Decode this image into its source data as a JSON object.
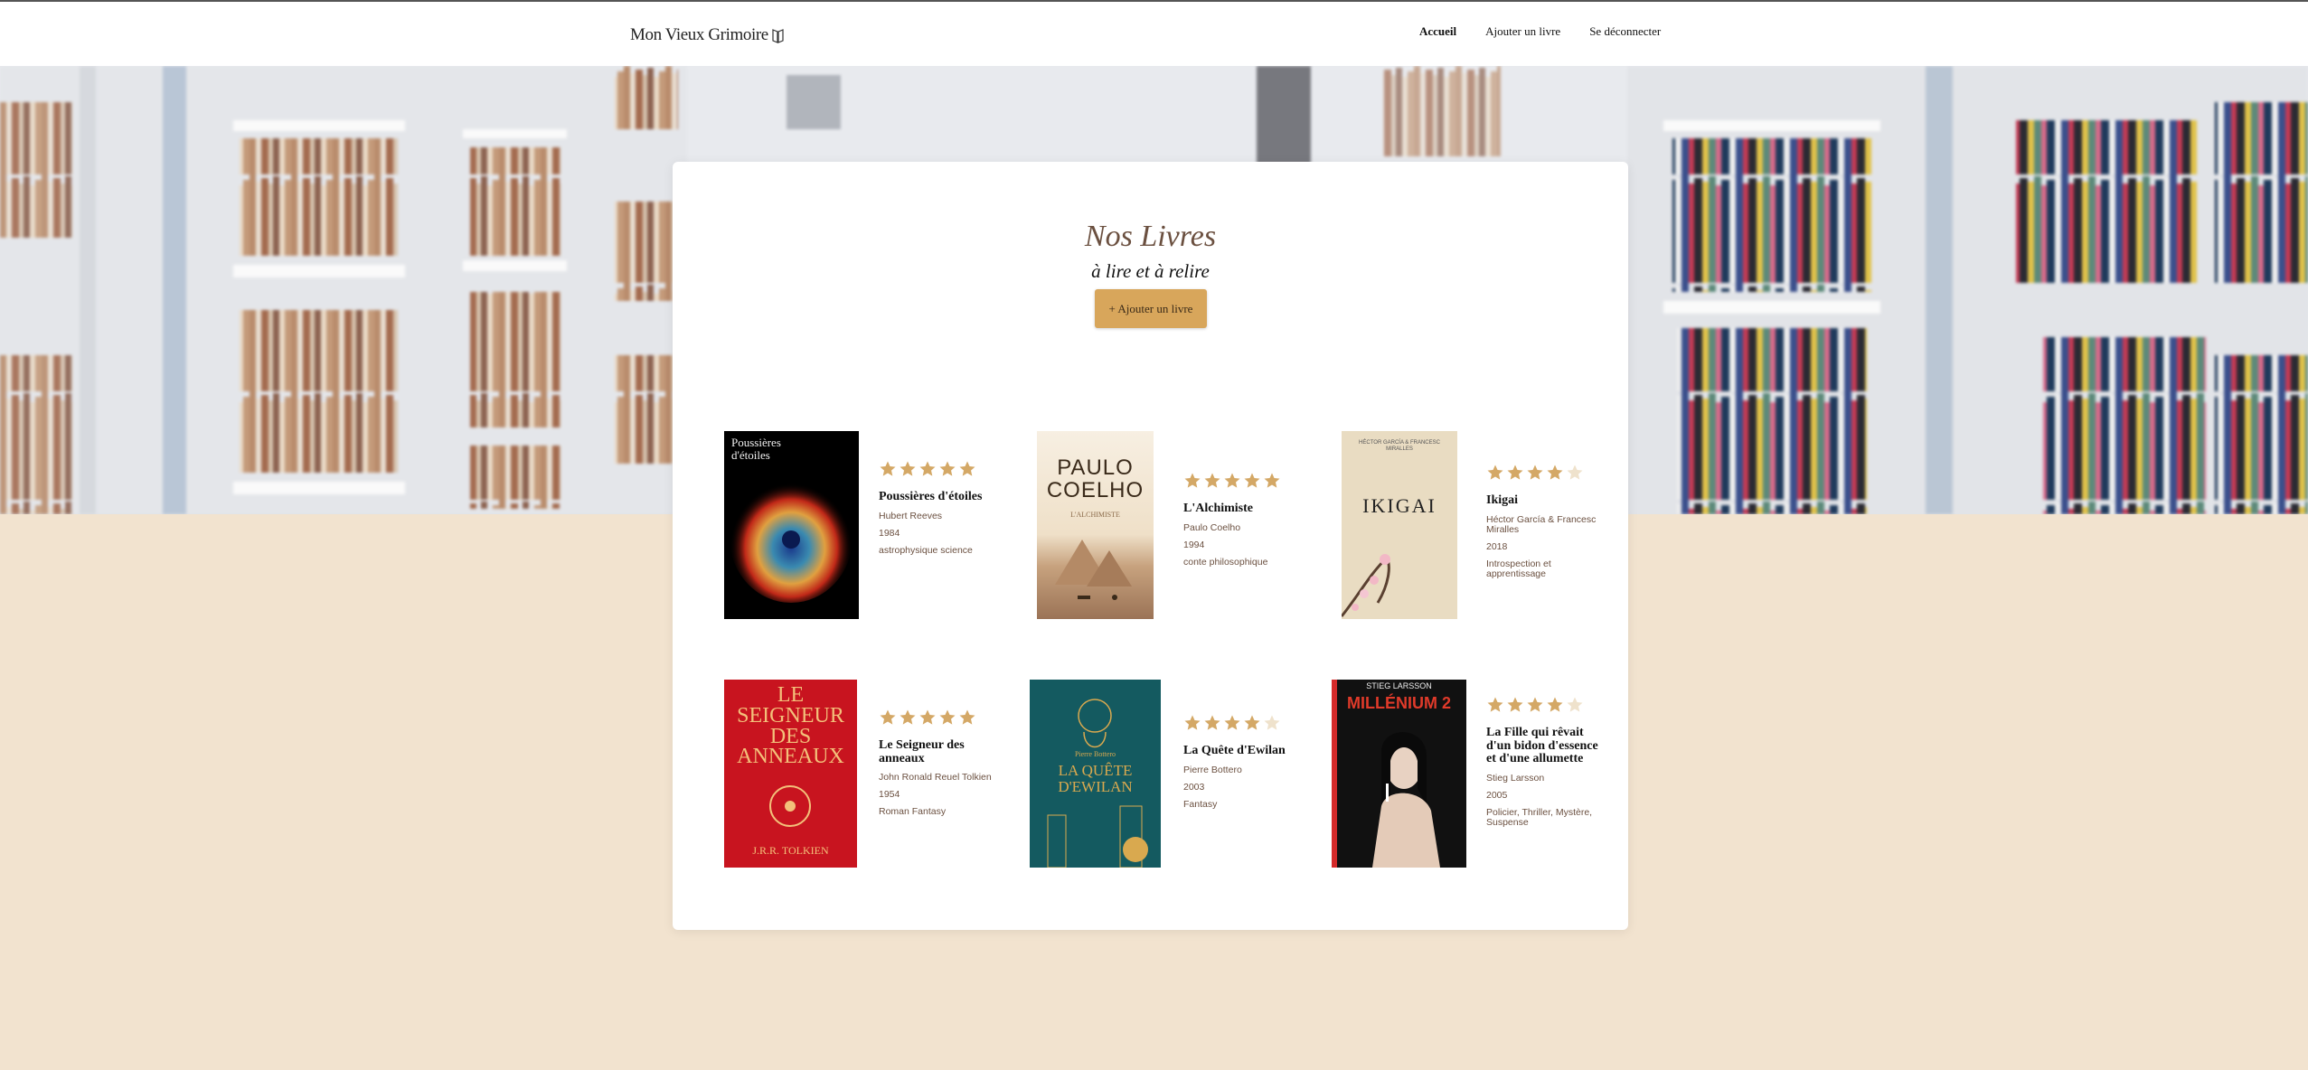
{
  "header": {
    "logo": "Mon Vieux Grimoire",
    "nav": [
      {
        "label": "Accueil",
        "active": true
      },
      {
        "label": "Ajouter un livre",
        "active": false
      },
      {
        "label": "Se déconnecter",
        "active": false
      }
    ]
  },
  "main": {
    "title": "Nos Livres",
    "subtitle": "à lire et à relire",
    "add_button": "+ Ajouter un livre"
  },
  "books": [
    {
      "title": "Poussières d'étoiles",
      "author": "Hubert Reeves",
      "year": "1984",
      "genre": "astrophysique science",
      "rating": 5,
      "cover_title": "Poussières d'étoiles"
    },
    {
      "title": "L'Alchimiste",
      "author": "Paulo Coelho",
      "year": "1994",
      "genre": "conte philosophique",
      "rating": 5,
      "cover_title": "PAULO COELHO",
      "cover_sub": "L'ALCHIMISTE"
    },
    {
      "title": "Ikigai",
      "author": "Héctor García & Francesc Miralles",
      "year": "2018",
      "genre": "Introspection et apprentissage",
      "rating": 4,
      "cover_title": "IKIGAI",
      "cover_sub": "HÉCTOR GARCÍA & FRANCESC MIRALLES"
    },
    {
      "title": "Le Seigneur des anneaux",
      "author": "John Ronald Reuel Tolkien",
      "year": "1954",
      "genre": "Roman Fantasy",
      "rating": 5,
      "cover_title": "LE SEIGNEUR DES ANNEAUX",
      "cover_sub": "J.R.R. TOLKIEN"
    },
    {
      "title": "La Quête d'Ewilan",
      "author": "Pierre Bottero",
      "year": "2003",
      "genre": "Fantasy",
      "rating": 4,
      "cover_title": "LA QUÊTE D'EWILAN",
      "cover_sub": "Pierre Bottero"
    },
    {
      "title": "La Fille qui rêvait d'un bidon d'essence et d'une allumette",
      "author": "Stieg Larsson",
      "year": "2005",
      "genre": "Policier, Thriller, Mystère, Suspense",
      "rating": 4,
      "cover_title": "MILLÉNIUM 2",
      "cover_sub": "STIEG LARSSON"
    }
  ],
  "colors": {
    "accent": "#d8a65b",
    "star_on": "#d4a866",
    "star_off": "#efe2cc",
    "background": "#f2e3cf",
    "title": "#6b5040"
  },
  "icons": {
    "star": "star-icon",
    "logo": "book-logo-icon"
  }
}
